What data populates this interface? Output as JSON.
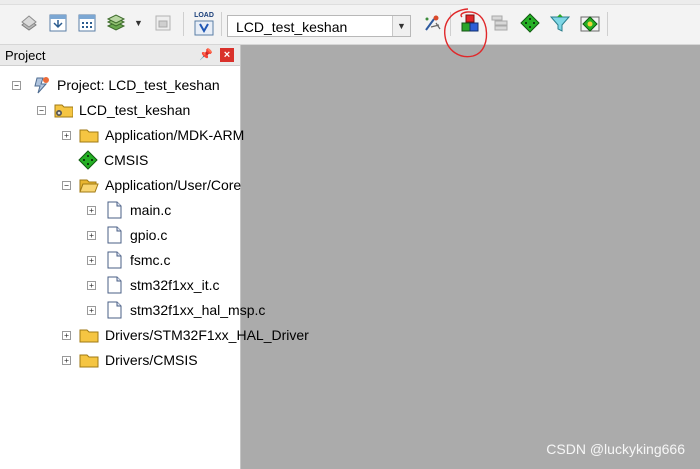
{
  "toolbar": {
    "target_name": "LCD_test_keshan",
    "load_label": "LOAD",
    "icons": [
      "translate-icon",
      "build-icon",
      "rebuild-icon",
      "batch-build-icon",
      "stop-build-icon",
      "download-icon",
      "target-options-icon",
      "manage-components-icon",
      "select-packs-icon",
      "pack-installer-icon",
      "rte-icon",
      "event-recorder-icon"
    ]
  },
  "panel": {
    "title": "Project"
  },
  "tree": [
    {
      "label": "Project: LCD_test_keshan",
      "icon": "project-icon"
    },
    {
      "label": "LCD_test_keshan",
      "icon": "target-folder-icon"
    },
    {
      "label": "Application/MDK-ARM",
      "icon": "folder-icon"
    },
    {
      "label": "CMSIS",
      "icon": "cmsis-diamond-icon"
    },
    {
      "label": "Application/User/Core",
      "icon": "folder-open-icon"
    },
    {
      "label": "main.c",
      "icon": "file-icon"
    },
    {
      "label": "gpio.c",
      "icon": "file-icon"
    },
    {
      "label": "fsmc.c",
      "icon": "file-icon"
    },
    {
      "label": "stm32f1xx_it.c",
      "icon": "file-icon"
    },
    {
      "label": "stm32f1xx_hal_msp.c",
      "icon": "file-icon"
    },
    {
      "label": "Drivers/STM32F1xx_HAL_Driver",
      "icon": "folder-icon"
    },
    {
      "label": "Drivers/CMSIS",
      "icon": "folder-icon"
    }
  ],
  "watermark": "CSDN @luckyking666",
  "colors": {
    "annotation_circle": "#e0282a",
    "folder": "#f5c542",
    "close": "#d9312b"
  }
}
